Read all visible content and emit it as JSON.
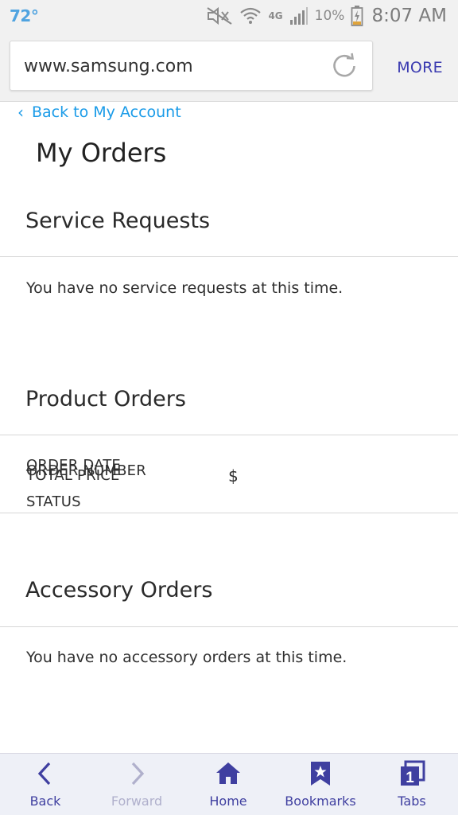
{
  "status_bar": {
    "temperature": "72°",
    "network": "4G",
    "battery_percent": "10%",
    "time": "8:07 AM"
  },
  "browser": {
    "url": "www.samsung.com",
    "more_label": "MORE"
  },
  "page": {
    "back_link": "Back to My Account",
    "title": "My Orders",
    "service_requests": {
      "heading": "Service Requests",
      "message": "You have no service requests at this time."
    },
    "product_orders": {
      "heading": "Product Orders",
      "order_date_label": "ORDER DATE",
      "order_number_label": "ORDER NUMBER",
      "total_price_label": "TOTAL PRICE",
      "price_value": "$",
      "status_label": "STATUS"
    },
    "accessory_orders": {
      "heading": "Accessory Orders",
      "message": "You have no accessory orders at this time."
    }
  },
  "bottom_nav": {
    "items": [
      {
        "label": "Back",
        "icon": "back-chevron-icon",
        "enabled": true
      },
      {
        "label": "Forward",
        "icon": "forward-chevron-icon",
        "enabled": false
      },
      {
        "label": "Home",
        "icon": "home-icon",
        "enabled": true
      },
      {
        "label": "Bookmarks",
        "icon": "bookmark-star-icon",
        "enabled": true
      },
      {
        "label": "Tabs",
        "icon": "tabs-icon",
        "tab_count": "1",
        "enabled": true
      }
    ]
  },
  "colors": {
    "link_blue": "#1a9be8",
    "nav_purple": "#3f3fa0",
    "temp_blue": "#4fa3e0"
  }
}
